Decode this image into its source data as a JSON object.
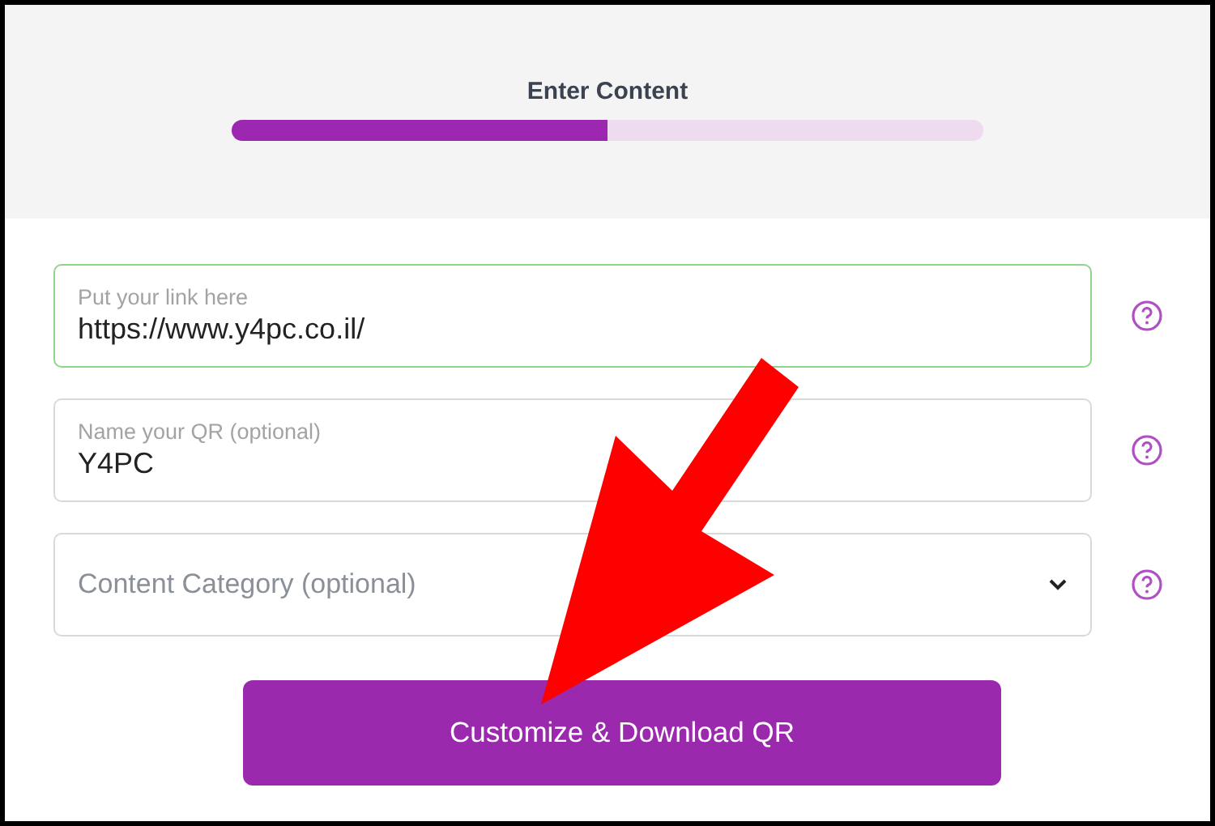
{
  "header": {
    "title": "Enter Content",
    "progress": {
      "level": 0.5
    }
  },
  "fields": [
    {
      "kind": "text",
      "placeholder": "Put your link here",
      "value": "https://www.y4pc.co.il/",
      "focused": true
    },
    {
      "kind": "text",
      "placeholder": "Name your QR (optional)",
      "value": "Y4PC",
      "focused": false
    },
    {
      "kind": "select",
      "placeholder": "Content Category (optional)",
      "focused": false
    }
  ],
  "button": {
    "label": "Customize & Download QR"
  }
}
